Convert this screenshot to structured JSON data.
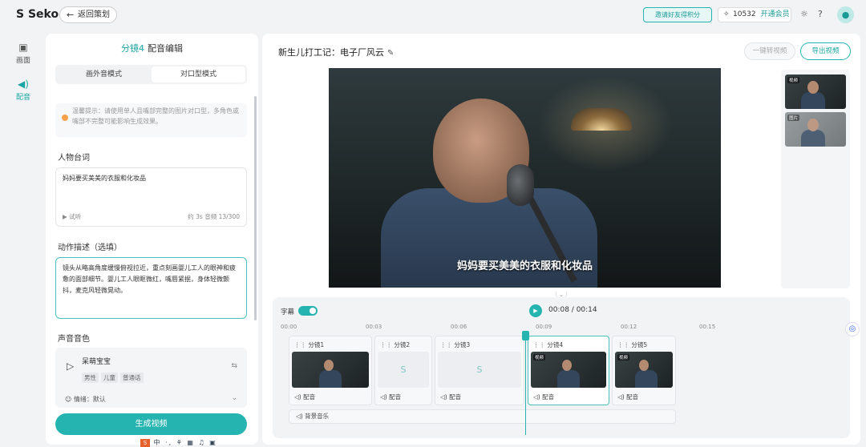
{
  "header": {
    "logo": "Seko",
    "back_label": "返回策划",
    "invite_label": "邀请好友得积分",
    "points": "10532",
    "vip_label": "开通会员"
  },
  "rail": [
    {
      "label": "画面",
      "icon": "image-icon"
    },
    {
      "label": "配音",
      "icon": "speaker-icon"
    }
  ],
  "left_panel": {
    "shot": "分镜4",
    "title": "配音编辑",
    "modes": [
      "画外音模式",
      "对口型模式"
    ],
    "active_mode": "对口型模式",
    "tip": "温馨提示：请使用单人且嘴部完整的图片对口型，多角色或嘴部不完整可能影响生成效果。",
    "dialogue_label": "人物台词",
    "dialogue_text": "妈妈要买美美的衣服和化妆品",
    "try_label": "试听",
    "dialogue_count": "约 3s 音频 13/300",
    "action_label": "动作描述（选填）",
    "action_text": "镜头从略高角度缓慢俯视拉近，重点刻画婴儿工人的眼神和疲惫的面部细节。婴儿工人眼眶微红，嘴唇紧抿，身体轻微颤抖，麦克风轻微晃动。",
    "voice_label": "声音音色",
    "voice_name": "呆萌宝宝",
    "voice_tags": [
      "男性",
      "儿童",
      "普通话"
    ],
    "emotion": "情绪：默认",
    "generate_label": "生成视频"
  },
  "main": {
    "title": "新生儿打工记：电子厂风云",
    "convert_label": "一键转视频",
    "export_label": "导出视频",
    "subtitle": "妈妈要买美美的衣服和化妆品",
    "thumb_tags": [
      "视频",
      "图片"
    ]
  },
  "timeline": {
    "subtitle_label": "字幕",
    "time": "00:08 / 00:14",
    "ticks": [
      "00:00",
      "00:03",
      "00:06",
      "00:09",
      "00:12",
      "00:15"
    ],
    "clips": [
      {
        "label": "分镜1",
        "kind": "image",
        "audio": "配音"
      },
      {
        "label": "分镜2",
        "kind": "placeholder",
        "audio": "配音"
      },
      {
        "label": "分镜3",
        "kind": "placeholder",
        "audio": "配音"
      },
      {
        "label": "分镜4",
        "kind": "video",
        "tag": "视频",
        "audio": "配音"
      },
      {
        "label": "分镜5",
        "kind": "video",
        "tag": "视频",
        "audio": "配音"
      }
    ],
    "bgm_label": "背景音乐"
  },
  "ime_text": "中 ·, ⚘ ▦ ♫ ▣"
}
